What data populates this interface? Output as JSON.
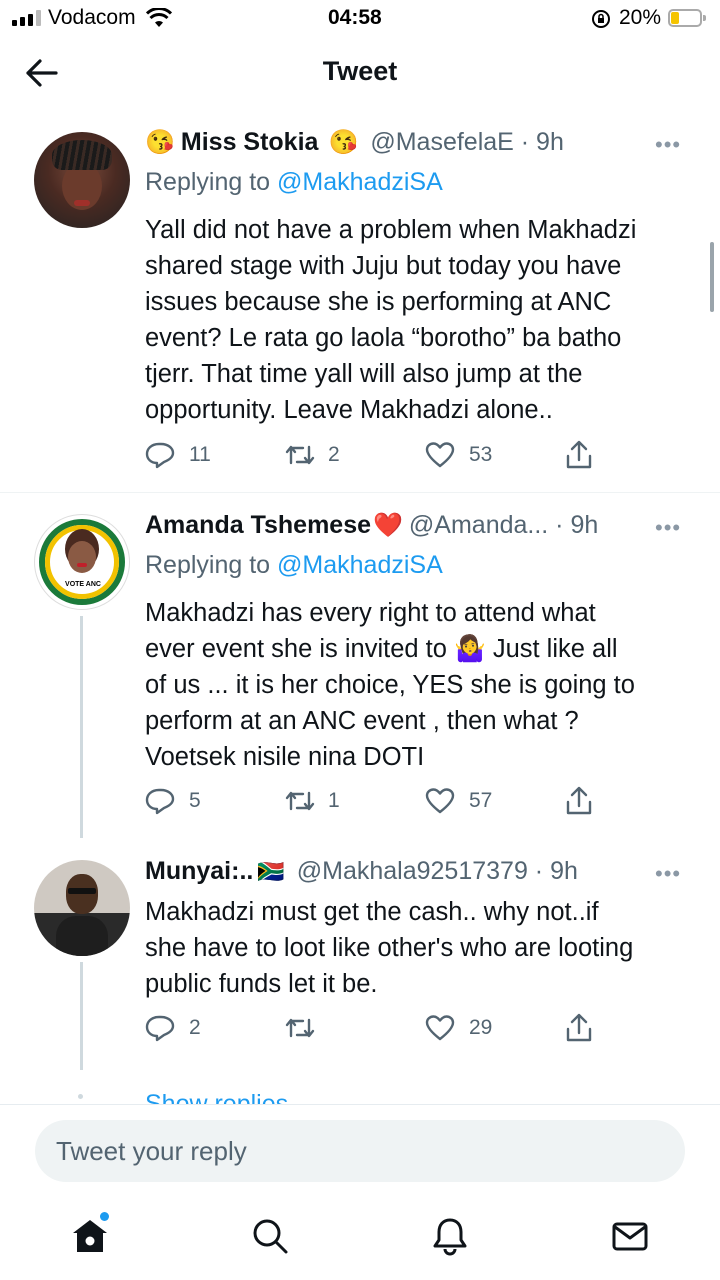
{
  "status_bar": {
    "carrier": "Vodacom",
    "time": "04:58",
    "battery": "20%"
  },
  "header": {
    "title": "Tweet",
    "back_icon": "arrow-left-icon"
  },
  "tweets": [
    {
      "name": "Miss Stokia",
      "emoji_left": "😘",
      "emoji_right": "😘",
      "handle": "@MasefelaE · 9h",
      "replying_prefix": "Replying to",
      "replying_to": "@MakhadziSA",
      "body_lines": [
        "Yall did not have a problem when Makhadzi",
        "shared stage with Juju but today you have",
        "issues because she is performing at ANC",
        "event? Le rata go laola “borotho” ba batho",
        "tjerr. That time yall will also jump at the",
        "opportunity. Leave Makhadzi alone.."
      ],
      "replies": "11",
      "retweets": "2",
      "likes": "53"
    },
    {
      "name": "Amanda Tshemese",
      "emoji_right": "❤️",
      "handle": "@Amanda... · 9h",
      "replying_prefix": "Replying to",
      "replying_to": "@MakhadziSA",
      "body_lines": [
        "Makhadzi has every right to attend what",
        "ever event she is invited to 🤷‍♀️ Just like all",
        "of us ... it is her choice, YES she is going to",
        "perform at an ANC event , then what ?",
        "Voetsek nisile nina DOTI"
      ],
      "avatar_text_top": "REGISTERED TO VOTE ANC",
      "replies": "5",
      "retweets": "1",
      "likes": "57"
    },
    {
      "name": "Munyai:..",
      "emoji_right": "🇿🇦",
      "handle": "@Makhala92517379 · 9h",
      "body_lines": [
        "Makhadzi must get the cash.. why not..if",
        "she have to loot like other's who are looting",
        "public funds let it be."
      ],
      "replies": "2",
      "retweets": "",
      "likes": "29"
    }
  ],
  "show_replies": "Show replies",
  "reply_placeholder": "Tweet your reply",
  "tabs": [
    "home-icon",
    "search-icon",
    "bell-icon",
    "mail-icon"
  ],
  "colors": {
    "accent": "#1d9bf0",
    "muted": "#536471",
    "text": "#0f1419"
  }
}
